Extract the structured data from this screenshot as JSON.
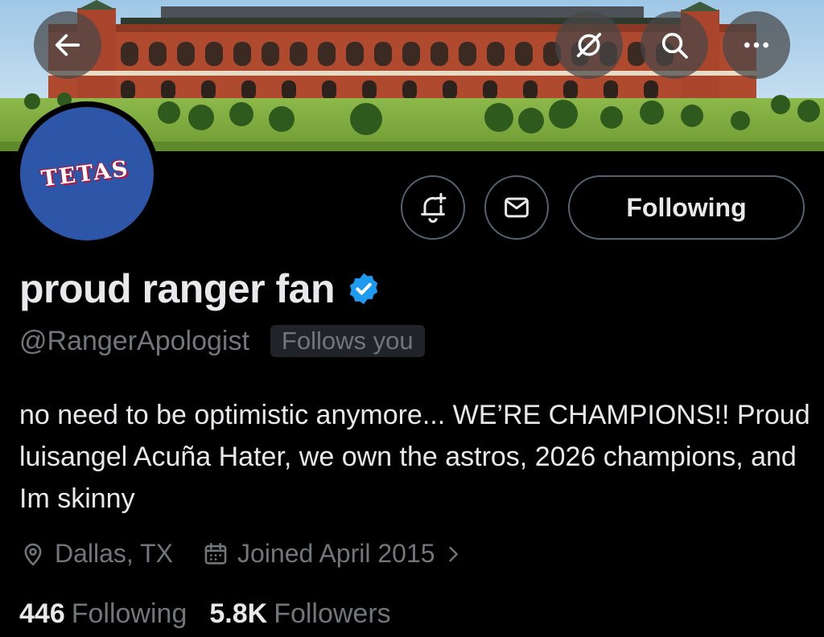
{
  "colors": {
    "background": "#000000",
    "text_primary": "#e7e9ea",
    "text_secondary": "#71767b",
    "border": "#536471",
    "verified": "#1d9bf0",
    "avatar_bg": "#2d55a8",
    "avatar_accent": "#c8102e"
  },
  "header": {
    "back_icon": "arrow-left-icon",
    "unsubscribe_icon": "bell-slash-icon",
    "search_icon": "search-icon",
    "more_icon": "more-horizontal-icon"
  },
  "avatar": {
    "text": "TETAS"
  },
  "actions": {
    "notify_icon": "bell-plus-icon",
    "message_icon": "envelope-icon",
    "following_label": "Following"
  },
  "profile": {
    "display_name": "proud ranger fan",
    "verified": true,
    "handle": "@RangerApologist",
    "follows_you": "Follows you",
    "bio": "no need to be optimistic anymore... WE’RE CHAMPIONS!! Proud luisangel Acuña Hater, we own the astros, 2026 champions, and Im skinny",
    "location": "Dallas, TX",
    "joined": "Joined April 2015",
    "location_icon": "location-pin-icon",
    "calendar_icon": "calendar-icon"
  },
  "stats": {
    "following_count": "446",
    "following_label": "Following",
    "followers_count": "5.8K",
    "followers_label": "Followers"
  }
}
